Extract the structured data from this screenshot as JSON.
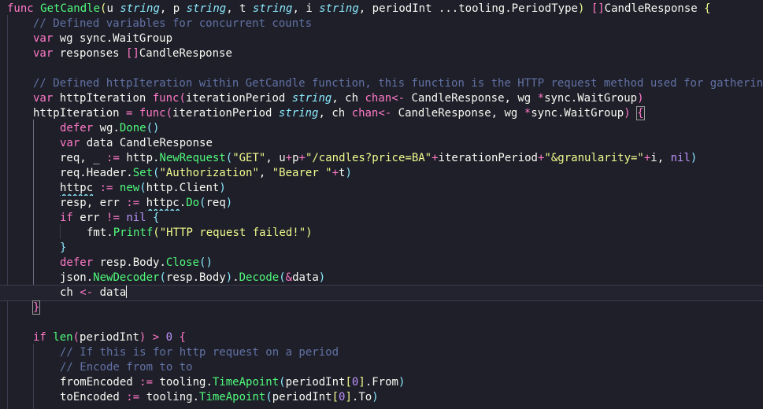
{
  "editor": {
    "language": "go",
    "cursor_line": 20
  },
  "lines": [
    "func GetCandle(u string, p string, t string, i string, periodInt ...tooling.PeriodType) []CandleResponse {",
    "    // Defined variables for concurrent counts",
    "    var wg sync.WaitGroup",
    "    var responses []CandleResponse",
    "",
    "    // Defined httpIteration within GetCandle function, this function is the HTTP request method used for gathering",
    "    var httpIteration func(iterationPeriod string, ch chan<- CandleResponse, wg *sync.WaitGroup)",
    "    httpIteration = func(iterationPeriod string, ch chan<- CandleResponse, wg *sync.WaitGroup) {",
    "        defer wg.Done()",
    "        var data CandleResponse",
    "        req, _ := http.NewRequest(\"GET\", u+p+\"/candles?price=BA\"+iterationPeriod+\"&granularity=\"+i, nil)",
    "        req.Header.Set(\"Authorization\", \"Bearer \"+t)",
    "        httpc := new(http.Client)",
    "        resp, err := httpc.Do(req)",
    "        if err != nil {",
    "            fmt.Printf(\"HTTP request failed!\")",
    "        }",
    "        defer resp.Body.Close()",
    "        json.NewDecoder(resp.Body).Decode(&data)",
    "        ch <- data",
    "    }",
    "",
    "    if len(periodInt) > 0 {",
    "        // If this is for http request on a period",
    "        // Encode from to to",
    "        fromEncoded := tooling.TimeApoint(periodInt[0].From)",
    "        toEncoded := tooling.TimeApoint(periodInt[0].To)"
  ]
}
